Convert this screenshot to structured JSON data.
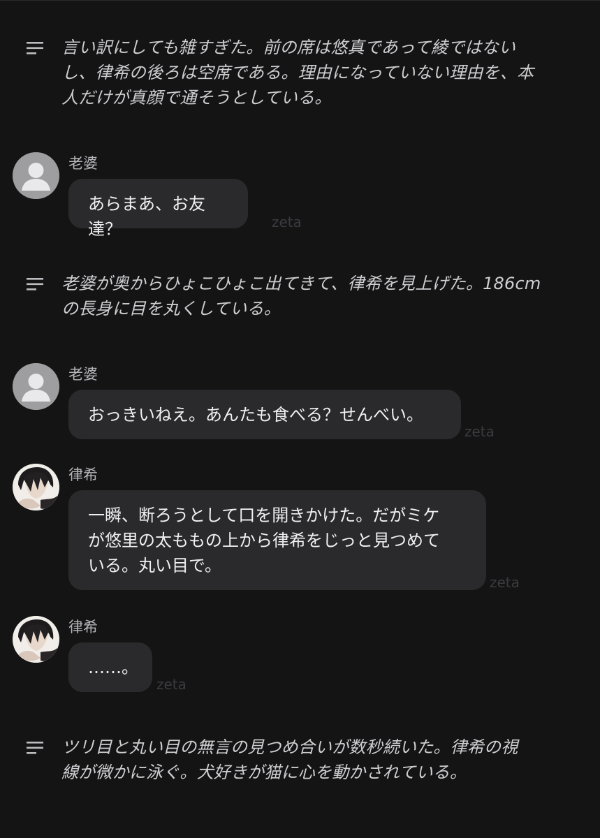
{
  "narrations": [
    {
      "text_lines": [
        "言い訳にしても雑すぎた。前の席は悠真であって綾ではない",
        "し、律希の後ろは空席である。理由になっていない理由を、本",
        "人だけが真顔で通そうとしている。"
      ]
    },
    {
      "text_lines": [
        "老婆が奥からひょこひょこ出てきて、律希を見上げた。186cm",
        "の長身に目を丸くしている。"
      ]
    },
    {
      "text_lines": [
        "ツリ目と丸い目の無言の見つめ合いが数秒続いた。律希の視",
        "線が微かに泳ぐ。犬好きが猫に心を動かされている。"
      ]
    }
  ],
  "messages": [
    {
      "speaker": "老婆",
      "avatar": "default-user-icon",
      "text_lines": [
        "あらまあ、お友達？"
      ],
      "watermark": "zeta"
    },
    {
      "speaker": "老婆",
      "avatar": "default-user-icon",
      "text_lines": [
        "おっきいねえ。あんたも食べる？せんべい。"
      ],
      "watermark": "zeta"
    },
    {
      "speaker": "律希",
      "avatar": "character-portrait",
      "text_lines": [
        "一瞬、断ろうとして口を開きかけた。だがミケ",
        "が悠里の太ももの上から律希をじっと見つめて",
        "いる。丸い目で。"
      ],
      "watermark": "zeta"
    },
    {
      "speaker": "律希",
      "avatar": "character-portrait",
      "text_lines": [
        "……。"
      ],
      "watermark": "zeta"
    }
  ],
  "colors": {
    "background": "#141415",
    "bubble": "#2a2a2d",
    "narration_text": "#cfcfd2",
    "name_text": "#b6b6ba",
    "watermark": "#3b3b3f"
  }
}
